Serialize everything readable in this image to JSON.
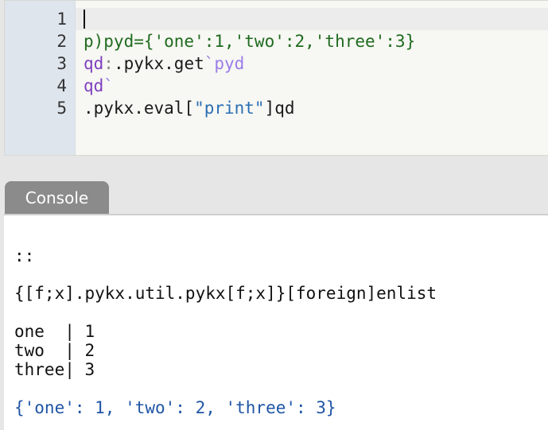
{
  "editor": {
    "lines": [
      {
        "number": "1",
        "tokens": []
      },
      {
        "number": "2",
        "tokens": [
          {
            "text": "p)pyd={'one':1,'two':2,'three':3}",
            "color": "green"
          }
        ]
      },
      {
        "number": "3",
        "tokens": [
          {
            "text": "qd",
            "color": "purple"
          },
          {
            "text": ":",
            "color": "gray"
          },
          {
            "text": ".pykx.get",
            "color": "default"
          },
          {
            "text": "`pyd",
            "color": "lavender"
          }
        ]
      },
      {
        "number": "4",
        "tokens": [
          {
            "text": "qd",
            "color": "purple"
          },
          {
            "text": "`",
            "color": "lavender"
          }
        ]
      },
      {
        "number": "5",
        "tokens": [
          {
            "text": ".pykx.eval[",
            "color": "default"
          },
          {
            "text": "\"print\"",
            "color": "blue"
          },
          {
            "text": "]qd",
            "color": "default"
          }
        ]
      }
    ]
  },
  "console": {
    "tab_label": "Console",
    "output": {
      "line1": "::",
      "line2": "{[f;x].pykx.util.pykx[f;x]}[foreign]enlist",
      "table": [
        "one  | 1",
        "two  | 2",
        "three| 3"
      ],
      "printed": "{'one': 1, 'two': 2, 'three': 3}"
    }
  },
  "colors": {
    "green": "#1f6b1f",
    "purple": "#7f3fbf",
    "lavender": "#9b7de8",
    "gray": "#8a8a8a",
    "blue": "#2b6fb3",
    "default": "#1a1a1a",
    "console_print_blue": "#1f55a5",
    "tab_bg": "#8b8b8b"
  }
}
